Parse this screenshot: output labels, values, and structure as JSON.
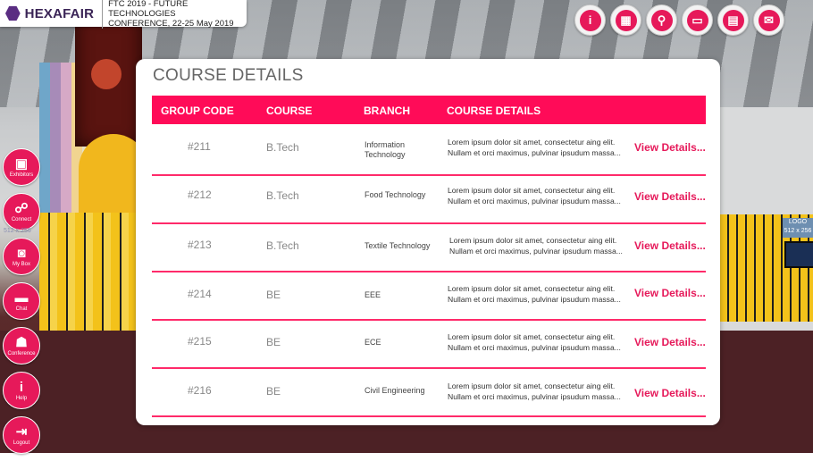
{
  "header": {
    "brand": "HEXAFAIR",
    "event_line1": "FTC 2019 - FUTURE TECHNOLOGIES",
    "event_line2": "CONFERENCE, 22-25 May 2019"
  },
  "top_icons": [
    {
      "name": "info-icon",
      "glyph": "i"
    },
    {
      "name": "store-icon",
      "glyph": "▦"
    },
    {
      "name": "search-person-icon",
      "glyph": "⚲"
    },
    {
      "name": "id-card-icon",
      "glyph": "▭"
    },
    {
      "name": "chat-icon",
      "glyph": "▤"
    },
    {
      "name": "mail-icon",
      "glyph": "✉"
    }
  ],
  "sidebar": {
    "items": [
      {
        "label": "Exhibitors",
        "icon": "exhibitors-icon",
        "glyph": "▣"
      },
      {
        "label": "Connect",
        "icon": "connect-icon",
        "glyph": "☍"
      },
      {
        "label": "My Box",
        "icon": "briefcase-icon",
        "glyph": "◙"
      },
      {
        "label": "Chat",
        "icon": "chat-bubble-icon",
        "glyph": "▬"
      },
      {
        "label": "Conference",
        "icon": "conference-icon",
        "glyph": "☗"
      },
      {
        "label": "Help",
        "icon": "help-icon",
        "glyph": "i"
      },
      {
        "label": "Logout",
        "icon": "logout-icon",
        "glyph": "⇥"
      }
    ],
    "placeholder_text": "512 x 256"
  },
  "background_labels": {
    "logo_card": "LOGO\n512 x 256"
  },
  "panel": {
    "title": "COURSE DETAILS",
    "columns": [
      "GROUP CODE",
      "COURSE",
      "BRANCH",
      "COURSE DETAILS"
    ],
    "view_label": "View Details...",
    "rows": [
      {
        "code": "#211",
        "course": "B.Tech",
        "branch": "Information Technology",
        "desc1": "Lorem ipsum dolor sit amet, consectetur aing elit.",
        "desc2": "Nullam et orci maximus, pulvinar ipsudum massa..."
      },
      {
        "code": "#212",
        "course": "B.Tech",
        "branch": "Food Technology",
        "desc1": "Lorem ipsum dolor sit amet, consectetur aing elit.",
        "desc2": "Nullam et orci maximus, pulvinar ipsudum massa..."
      },
      {
        "code": "#213",
        "course": "B.Tech",
        "branch": "Textile Technology",
        "desc1": "Lorem ipsum dolor sit amet, consectetur aing elit.",
        "desc2": "Nullam et orci maximus, pulvinar ipsudum massa..."
      },
      {
        "code": "#214",
        "course": "BE",
        "branch": "EEE",
        "desc1": "Lorem ipsum dolor sit amet, consectetur aing elit.",
        "desc2": "Nullam et orci maximus, pulvinar ipsudum massa..."
      },
      {
        "code": "#215",
        "course": "BE",
        "branch": "ECE",
        "desc1": "Lorem ipsum dolor sit amet, consectetur aing elit.",
        "desc2": "Nullam et orci maximus, pulvinar ipsudum massa..."
      },
      {
        "code": "#216",
        "course": "BE",
        "branch": "Civil Engineering",
        "desc1": "Lorem ipsum dolor sit amet, consectetur aing elit.",
        "desc2": "Nullam et orci maximus, pulvinar ipsudum massa..."
      }
    ]
  },
  "colors": {
    "accent": "#ff0b58",
    "brand": "#3a2456"
  }
}
